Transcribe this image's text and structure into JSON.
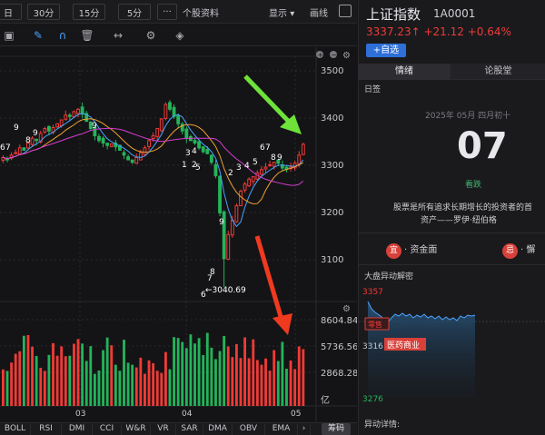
{
  "toolbar": {
    "periods": [
      "日",
      "30分",
      "15分",
      "5分"
    ],
    "more": "···",
    "profile": "个股资料",
    "display": "显示",
    "draw": "画线"
  },
  "chart": {
    "price_axis": [
      "3500",
      "3400",
      "3300",
      "3200",
      "3100"
    ],
    "low_label": "←3040.69",
    "vol_axis": [
      "8604.84",
      "5736.56",
      "2868.28",
      "亿"
    ],
    "months": [
      "03",
      "04",
      "05"
    ],
    "candle_labels": {
      "a": [
        "9",
        "6",
        "7",
        "8",
        "9"
      ],
      "b": [
        "9"
      ],
      "c": [
        "1",
        "2",
        "3",
        "4",
        "5"
      ],
      "d": [
        "9"
      ],
      "e": [
        "7",
        "8",
        "6"
      ],
      "f": [
        "2",
        "3",
        "4",
        "5",
        "6",
        "7",
        "8",
        "9"
      ]
    },
    "colors": {
      "up": "#ef3b36",
      "down": "#24b35a",
      "ma5": "#4aa3ff",
      "ma10": "#f0a030",
      "ma20": "#d63cd0"
    }
  },
  "chart_data": {
    "type": "candlestick",
    "ylim": [
      3030,
      3520
    ],
    "close_path": [
      3310,
      3305,
      3315,
      3320,
      3330,
      3325,
      3340,
      3350,
      3345,
      3360,
      3370,
      3365,
      3372,
      3380,
      3388,
      3398,
      3395,
      3405,
      3410,
      3400,
      3385,
      3370,
      3355,
      3345,
      3340,
      3335,
      3338,
      3332,
      3325,
      3315,
      3305,
      3300,
      3310,
      3320,
      3330,
      3345,
      3355,
      3370,
      3390,
      3420,
      3410,
      3395,
      3380,
      3365,
      3350,
      3345,
      3340,
      3330,
      3322,
      3318,
      3300,
      3272,
      3195,
      3100,
      3150,
      3180,
      3210,
      3240,
      3255,
      3265,
      3270,
      3278,
      3285,
      3290,
      3295,
      3300,
      3298,
      3288,
      3285,
      3290,
      3298,
      3315,
      3337.23
    ],
    "low": 3040.69,
    "last": 3337.23
  },
  "bottom_tabs": [
    "BOLL",
    "RSI",
    "DMI",
    "CCI",
    "W&R",
    "VR",
    "SAR",
    "DMA",
    "OBV",
    "EMA"
  ],
  "chip_button": "筹码",
  "panel": {
    "title": "上证指数",
    "code": "1A0001",
    "price_line": "3337.23↑ +21.12 +0.64%",
    "add_button": "+自选",
    "tabs": [
      "情绪",
      "论股堂"
    ],
    "sub_label": "日签",
    "date": "2025年 05月 四月初十",
    "day": "07",
    "mood": "看跌",
    "quote_line1": "股票是所有追求长期增长的投资者的首",
    "quote_line2": "资产——罗伊·纽伯格",
    "good_badge": "宜",
    "good_text": "· 资金面",
    "bad_badge": "忌",
    "bad_text": "· 懈",
    "alert_title": "大盘异动解密",
    "mini_axis": [
      "3357",
      "3316",
      "3276"
    ],
    "mini_tag1": "零售",
    "mini_tag2": "医药商业",
    "detail_title": "异动详情:"
  }
}
